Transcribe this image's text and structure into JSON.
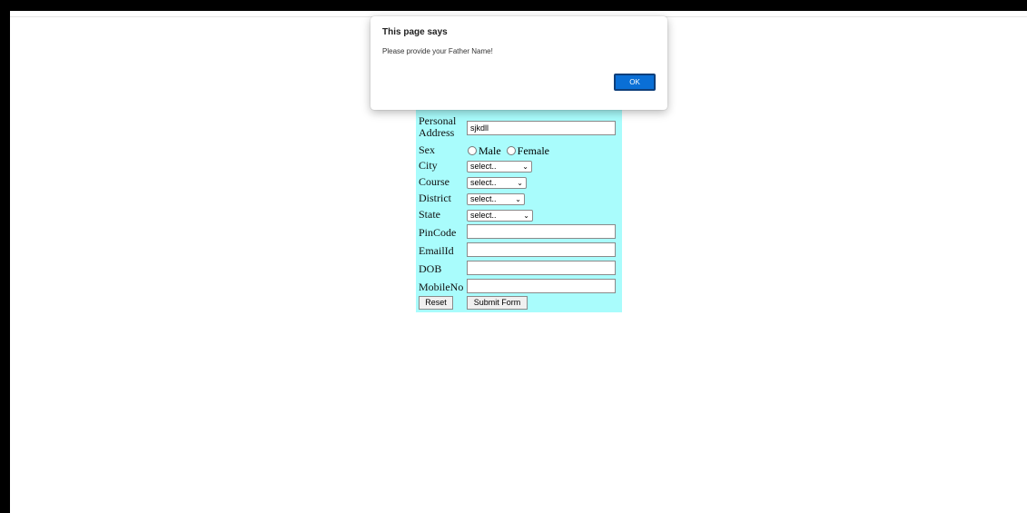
{
  "dialog": {
    "title": "This page says",
    "message": "Please provide your Father Name!",
    "ok_label": "OK"
  },
  "form": {
    "background_color": "#a9fcfc",
    "address_label": "Address",
    "personal_address_label_1": "Personal",
    "personal_address_label_2": "Address",
    "personal_address_value": "sjkdll",
    "sex_label": "Sex",
    "sex_options": [
      "Male",
      "Female"
    ],
    "city_label": "City",
    "city_value": "select..",
    "course_label": "Course",
    "course_value": "select..",
    "district_label": "District",
    "district_value": "select..",
    "state_label": "State",
    "state_value": "select..",
    "pincode_label": "PinCode",
    "email_label": "EmailId",
    "dob_label": "DOB",
    "mobile_label": "MobileNo",
    "reset_label": "Reset",
    "submit_label": "Submit Form"
  },
  "icons": {
    "select_chevron": "chevron-down-icon"
  }
}
